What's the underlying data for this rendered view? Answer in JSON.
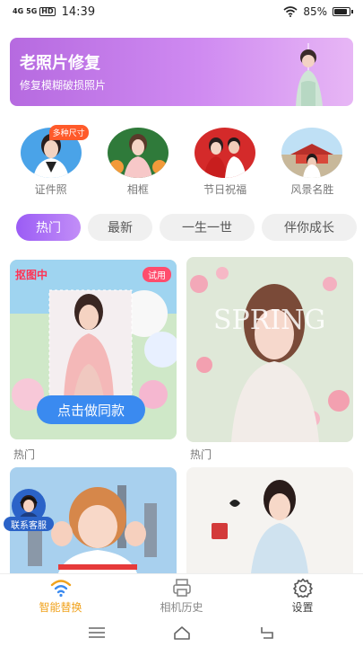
{
  "status_bar": {
    "signal_1": "4G",
    "signal_2": "5G",
    "hd": "HD",
    "time": "14:39",
    "battery_percent": "85%",
    "battery_level": 0.85
  },
  "banner": {
    "title": "老照片修复",
    "subtitle": "修复模糊破损照片"
  },
  "categories": [
    {
      "label": "证件照",
      "badge": "多种尺寸"
    },
    {
      "label": "相框"
    },
    {
      "label": "节日祝福"
    },
    {
      "label": "风景名胜"
    }
  ],
  "tabs": [
    {
      "label": "热门",
      "active": true
    },
    {
      "label": "最新",
      "active": false
    },
    {
      "label": "一生一世",
      "active": false
    },
    {
      "label": "伴你成长",
      "active": false
    }
  ],
  "cards": [
    {
      "caption": "热门",
      "cut_label": "抠图中",
      "try_badge": "试用",
      "button": "点击做同款"
    },
    {
      "caption": "热门",
      "art_text": "SPRING"
    }
  ],
  "service_label": "联系客服",
  "bottom_nav": [
    {
      "label": "智能替换",
      "icon": "wifi-icon",
      "active": true
    },
    {
      "label": "相机历史",
      "icon": "printer-icon",
      "active": false
    },
    {
      "label": "设置",
      "icon": "gear-icon",
      "active": false
    }
  ],
  "colors": {
    "accent": "#9b5cf5",
    "banner": "#c07ee8",
    "active_nav": "#f0a21c",
    "button_blue": "#3a8af0",
    "badge_red": "#ff4d6d"
  }
}
